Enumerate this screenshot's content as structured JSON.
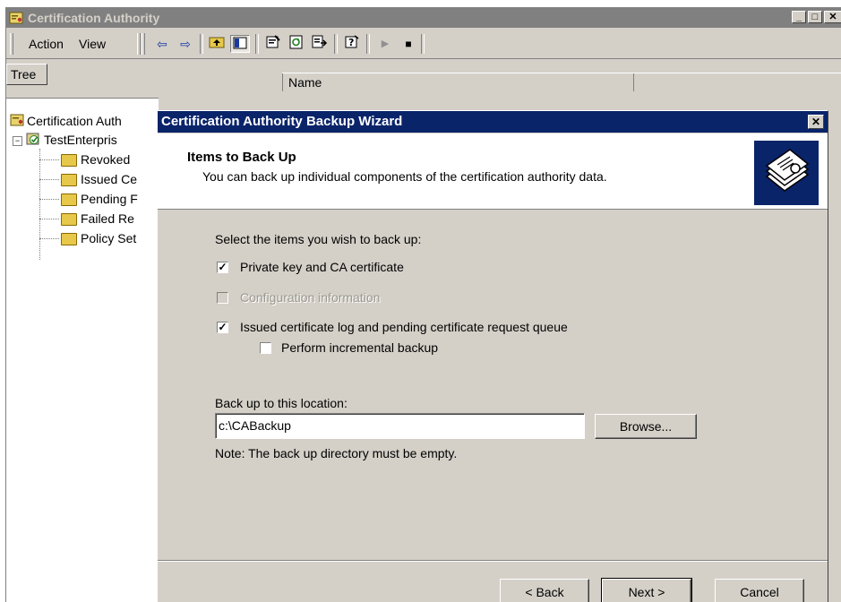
{
  "app": {
    "title": "Certification Authority",
    "window_buttons": [
      "_",
      "□",
      "✕"
    ]
  },
  "menu": {
    "action": "Action",
    "view": "View"
  },
  "toolbar": {
    "back_icon": "arrow-left-icon",
    "forward_icon": "arrow-right-icon",
    "up_icon": "up-folder-icon",
    "tree_icon": "show-tree-icon",
    "properties_icon": "properties-icon",
    "refresh_icon": "refresh-icon",
    "export_icon": "export-list-icon",
    "help_icon": "help-icon",
    "play_icon": "start-service-icon",
    "stop_icon": "stop-service-icon"
  },
  "panes": {
    "tree_tab": "Tree",
    "column_name": "Name"
  },
  "tree": {
    "root": "Certification Auth",
    "ca": "TestEnterpris",
    "children": [
      "Revoked",
      "Issued Ce",
      "Pending F",
      "Failed Re",
      "Policy Set"
    ]
  },
  "wizard": {
    "title": "Certification Authority Backup Wizard",
    "close": "✕",
    "header_title": "Items to Back Up",
    "header_subtitle": "You can back up individual components of the certification authority data.",
    "prompt": "Select the items you wish to back up:",
    "opt_private_key": "Private key and CA certificate",
    "opt_config": "Configuration information",
    "opt_issued_log": "Issued certificate log and pending certificate request queue",
    "opt_incremental": "Perform incremental backup",
    "location_label": "Back up to this location:",
    "location_value": "c:\\CABackup",
    "browse": "Browse...",
    "note": "Note: The back up directory must be empty.",
    "back": "< Back",
    "next": "Next >",
    "cancel": "Cancel",
    "checks": {
      "private_key": true,
      "config": false,
      "issued_log": true,
      "incremental": false
    }
  },
  "colors": {
    "wizard_title_bg": "#0a246a",
    "inactive_title_bg": "#808080",
    "dialog_face": "#d4d0c8"
  }
}
